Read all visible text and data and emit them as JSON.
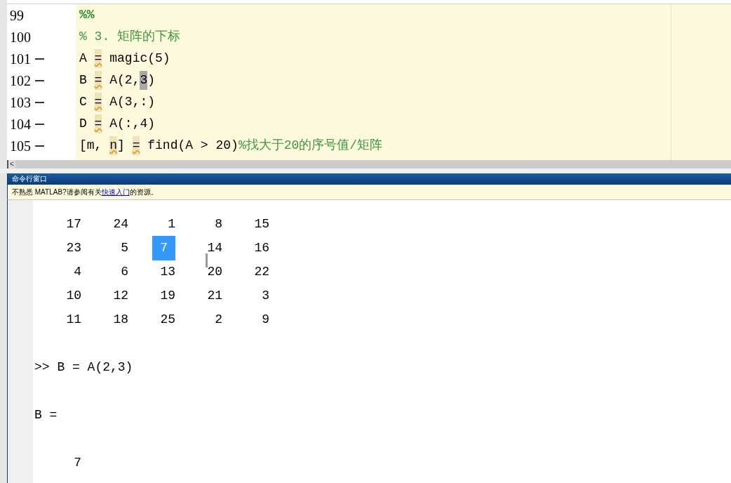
{
  "editor": {
    "lines": [
      {
        "number": "99",
        "executable": false,
        "segments": [
          {
            "kind": "cell",
            "text": "%%"
          }
        ]
      },
      {
        "number": "100",
        "executable": false,
        "segments": [
          {
            "kind": "comment",
            "text": "% 3. 矩阵的下标"
          }
        ]
      },
      {
        "number": "101",
        "executable": true,
        "segments": [
          {
            "kind": "plain",
            "text": "A "
          },
          {
            "kind": "marked",
            "text": "="
          },
          {
            "kind": "plain",
            "text": " magic(5)"
          }
        ]
      },
      {
        "number": "102",
        "executable": true,
        "segments": [
          {
            "kind": "plain",
            "text": "B "
          },
          {
            "kind": "marked",
            "text": "="
          },
          {
            "kind": "plain",
            "text": " A(2,"
          },
          {
            "kind": "selected",
            "text": "3"
          },
          {
            "kind": "plain",
            "text": ")"
          }
        ]
      },
      {
        "number": "103",
        "executable": true,
        "segments": [
          {
            "kind": "plain",
            "text": "C "
          },
          {
            "kind": "marked",
            "text": "="
          },
          {
            "kind": "plain",
            "text": " A(3,:)"
          }
        ]
      },
      {
        "number": "104",
        "executable": true,
        "segments": [
          {
            "kind": "plain",
            "text": "D "
          },
          {
            "kind": "marked",
            "text": "="
          },
          {
            "kind": "plain",
            "text": " A(:,4)"
          }
        ]
      },
      {
        "number": "105",
        "executable": true,
        "segments": [
          {
            "kind": "plain",
            "text": "[m, "
          },
          {
            "kind": "marked",
            "text": "n"
          },
          {
            "kind": "plain",
            "text": "] "
          },
          {
            "kind": "marked",
            "text": "="
          },
          {
            "kind": "plain",
            "text": " find(A > 20)"
          },
          {
            "kind": "comment",
            "text": "%找大于20的序号值/矩阵"
          }
        ]
      }
    ],
    "scroll_left": "<"
  },
  "command_window": {
    "title": "命令行窗口",
    "notice": {
      "before": "不熟悉 MATLAB?请参阅有关",
      "link": "快速入门",
      "after": "的资源。"
    },
    "matrix": [
      [
        {
          "value": "17",
          "selected": false
        },
        {
          "value": "24",
          "selected": false
        },
        {
          "value": "1",
          "selected": false
        },
        {
          "value": "8",
          "selected": false
        },
        {
          "value": "15",
          "selected": false
        }
      ],
      [
        {
          "value": "23",
          "selected": false
        },
        {
          "value": "5",
          "selected": false
        },
        {
          "value": "7",
          "selected": true
        },
        {
          "value": "14",
          "selected": false
        },
        {
          "value": "16",
          "selected": false
        }
      ],
      [
        {
          "value": "4",
          "selected": false
        },
        {
          "value": "6",
          "selected": false
        },
        {
          "value": "13",
          "selected": false
        },
        {
          "value": "20",
          "selected": false
        },
        {
          "value": "22",
          "selected": false
        }
      ],
      [
        {
          "value": "10",
          "selected": false
        },
        {
          "value": "12",
          "selected": false
        },
        {
          "value": "19",
          "selected": false
        },
        {
          "value": "21",
          "selected": false
        },
        {
          "value": "3",
          "selected": false
        }
      ],
      [
        {
          "value": "11",
          "selected": false
        },
        {
          "value": "18",
          "selected": false
        },
        {
          "value": "25",
          "selected": false
        },
        {
          "value": "2",
          "selected": false
        },
        {
          "value": "9",
          "selected": false
        }
      ]
    ],
    "lines": [
      {
        "kind": "prompt",
        "text": ">> B = A(2,3)"
      },
      {
        "kind": "output",
        "text": "B ="
      },
      {
        "kind": "value",
        "text": "7"
      }
    ]
  }
}
